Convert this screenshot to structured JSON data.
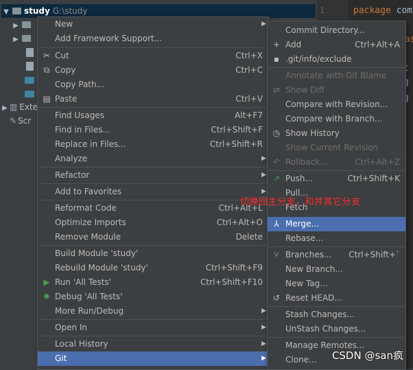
{
  "project_tree": {
    "root_name": "study",
    "root_path": "G:\\study",
    "external_libraries_label": "Exte",
    "scratches_label": "Scr"
  },
  "editor": {
    "line_number": "1",
    "code_keyword": "package",
    "code_rest": " com",
    "fragments": [
      "as",
      "t",
      "g",
      "g"
    ]
  },
  "context_menu": {
    "items": [
      {
        "label": "New",
        "shortcut": "",
        "submenu": true
      },
      {
        "label": "Add Framework Support...",
        "shortcut": ""
      },
      {
        "label": "Cut",
        "shortcut": "Ctrl+X",
        "icon": "scissors-icon"
      },
      {
        "label": "Copy",
        "shortcut": "Ctrl+C",
        "icon": "copy-icon"
      },
      {
        "label": "Copy Path...",
        "shortcut": ""
      },
      {
        "label": "Paste",
        "shortcut": "Ctrl+V",
        "icon": "paste-icon"
      },
      {
        "label": "Find Usages",
        "shortcut": "Alt+F7"
      },
      {
        "label": "Find in Files...",
        "shortcut": "Ctrl+Shift+F"
      },
      {
        "label": "Replace in Files...",
        "shortcut": "Ctrl+Shift+R"
      },
      {
        "label": "Analyze",
        "shortcut": "",
        "submenu": true
      },
      {
        "label": "Refactor",
        "shortcut": "",
        "submenu": true
      },
      {
        "label": "Add to Favorites",
        "shortcut": "",
        "submenu": true
      },
      {
        "label": "Reformat Code",
        "shortcut": "Ctrl+Alt+L"
      },
      {
        "label": "Optimize Imports",
        "shortcut": "Ctrl+Alt+O"
      },
      {
        "label": "Remove Module",
        "shortcut": "Delete"
      },
      {
        "label": "Build Module 'study'",
        "shortcut": ""
      },
      {
        "label": "Rebuild Module 'study'",
        "shortcut": "Ctrl+Shift+F9"
      },
      {
        "label": "Run 'All Tests'",
        "shortcut": "Ctrl+Shift+F10",
        "icon": "run-icon"
      },
      {
        "label": "Debug 'All Tests'",
        "shortcut": "",
        "icon": "debug-icon"
      },
      {
        "label": "More Run/Debug",
        "shortcut": "",
        "submenu": true
      },
      {
        "label": "Open In",
        "shortcut": "",
        "submenu": true
      },
      {
        "label": "Local History",
        "shortcut": "",
        "submenu": true
      },
      {
        "label": "Git",
        "shortcut": "",
        "submenu": true,
        "selected": true
      }
    ]
  },
  "git_menu": {
    "items": [
      {
        "label": "Commit Directory...",
        "shortcut": ""
      },
      {
        "label": "Add",
        "shortcut": "Ctrl+Alt+A",
        "icon": "plus-icon"
      },
      {
        "label": ".git/info/exclude",
        "shortcut": "",
        "icon": "exclude-icon"
      },
      {
        "label": "Annotate with Git Blame",
        "shortcut": "",
        "disabled": true
      },
      {
        "label": "Show Diff",
        "shortcut": "",
        "disabled": true,
        "icon": "diff-icon"
      },
      {
        "label": "Compare with Revision...",
        "shortcut": ""
      },
      {
        "label": "Compare with Branch...",
        "shortcut": ""
      },
      {
        "label": "Show History",
        "shortcut": "",
        "icon": "clock-icon"
      },
      {
        "label": "Show Current Revision",
        "shortcut": "",
        "disabled": true
      },
      {
        "label": "Rollback...",
        "shortcut": "Ctrl+Alt+Z",
        "disabled": true,
        "icon": "rollback-icon"
      },
      {
        "label": "Push...",
        "shortcut": "Ctrl+Shift+K",
        "icon": "push-icon"
      },
      {
        "label": "Pull...",
        "shortcut": ""
      },
      {
        "label": "Fetch",
        "shortcut": ""
      },
      {
        "label": "Merge...",
        "shortcut": "",
        "selected": true,
        "icon": "merge-icon"
      },
      {
        "label": "Rebase...",
        "shortcut": ""
      },
      {
        "label": "Branches...",
        "shortcut": "Ctrl+Shift+`",
        "icon": "branch-icon"
      },
      {
        "label": "New Branch...",
        "shortcut": ""
      },
      {
        "label": "New Tag...",
        "shortcut": ""
      },
      {
        "label": "Reset HEAD...",
        "shortcut": "",
        "icon": "reset-icon"
      },
      {
        "label": "Stash Changes...",
        "shortcut": ""
      },
      {
        "label": "UnStash Changes...",
        "shortcut": ""
      },
      {
        "label": "Manage Remotes...",
        "shortcut": ""
      },
      {
        "label": "Clone...",
        "shortcut": ""
      }
    ]
  },
  "annotation": "切换回主分支，和并其它分支",
  "watermark": "CSDN @san疯",
  "colors": {
    "selection": "#4b6eaf",
    "annotation_red": "#ff2b2b",
    "keyword_orange": "#cc7832",
    "run_green": "#499c54"
  }
}
